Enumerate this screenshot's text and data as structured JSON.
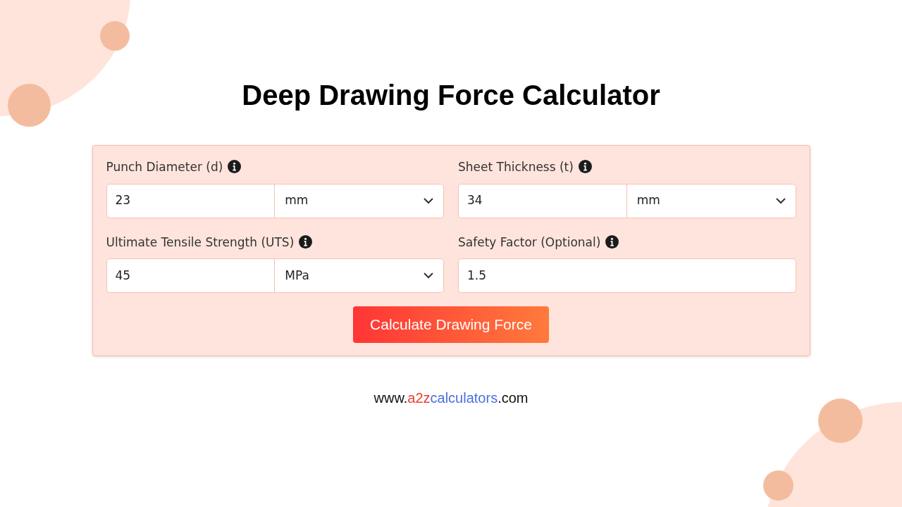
{
  "title": "Deep Drawing Force Calculator",
  "fields": [
    {
      "label": "Punch Diameter (d)",
      "value": "23",
      "unit": "mm",
      "kind": "unit"
    },
    {
      "label": "Sheet Thickness (t)",
      "value": "34",
      "unit": "mm",
      "kind": "unit"
    },
    {
      "label": "Ultimate Tensile Strength (UTS)",
      "value": "45",
      "unit": "MPa",
      "kind": "unit"
    },
    {
      "label": "Safety Factor (Optional)",
      "value": "1.5",
      "kind": "plain"
    }
  ],
  "button": "Calculate Drawing Force",
  "footer": [
    {
      "text": "www.",
      "color": "#111111"
    },
    {
      "text": "a2z",
      "color": "#e8402c"
    },
    {
      "text": "calculators",
      "color": "#4a6fe0"
    },
    {
      "text": ".com",
      "color": "#111111"
    }
  ]
}
